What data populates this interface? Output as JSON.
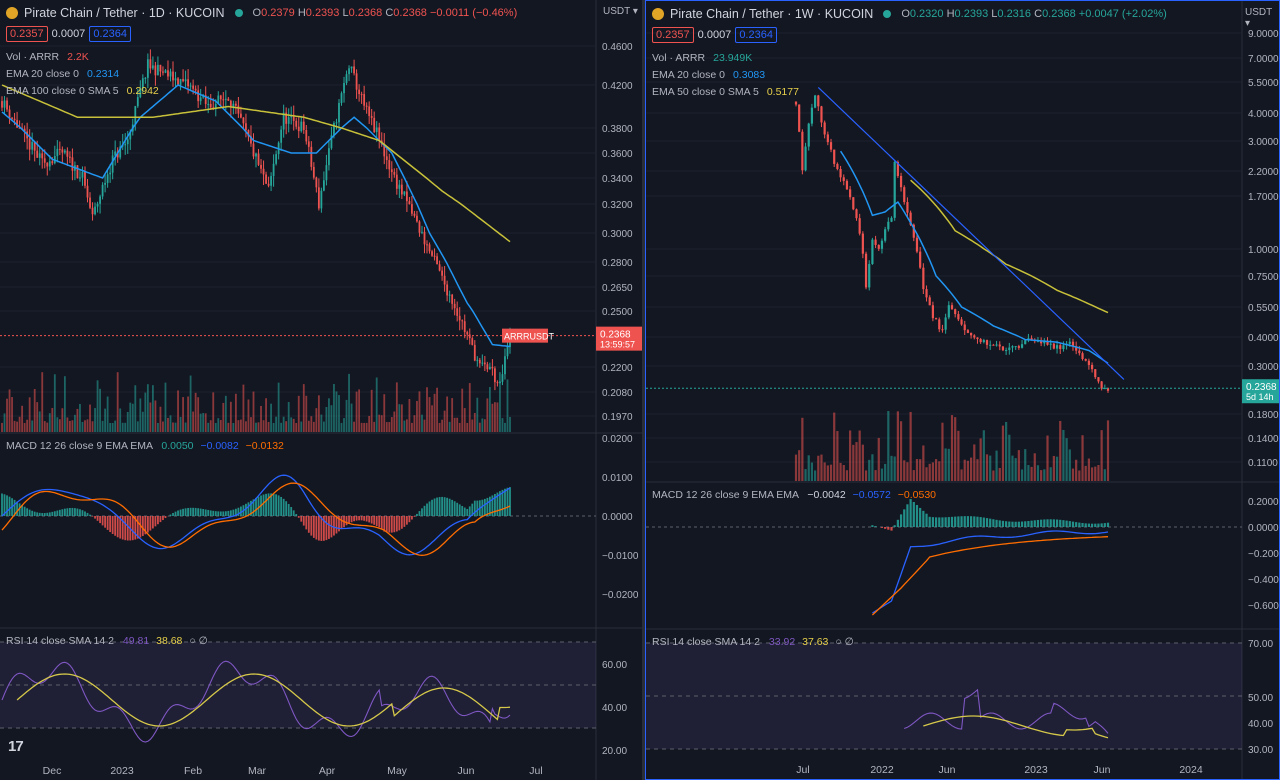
{
  "left": {
    "title": "Pirate Chain / Tether · 1D · KUCOIN",
    "ohlc": {
      "o_label": "O",
      "o": "0.2379",
      "h_label": "H",
      "h": "0.2393",
      "l_label": "L",
      "l": "0.2368",
      "c_label": "C",
      "c": "0.2368",
      "chg": "−0.0011 (−0.46%)"
    },
    "bid": "0.2357",
    "spread": "0.0007",
    "ask": "0.2364",
    "vol_label": "Vol · ARRR",
    "vol_value": "2.2K",
    "ema1_label": "EMA 20 close 0",
    "ema1_value": "0.2314",
    "ema2_label": "EMA 100 close 0 SMA 5",
    "ema2_value": "0.2942",
    "currency": "USDT ▾",
    "price_label_symbol": "ARRRUSDT",
    "price_label_value": "0.2368",
    "price_label_timer": "13:59:57",
    "macd_title": "MACD 12 26 close 9 EMA EMA",
    "macd_values": [
      "0.0050",
      "−0.0082",
      "−0.0132"
    ],
    "rsi_title": "RSI 14 close SMA 14 2",
    "rsi_values": [
      "49.81",
      "38.68"
    ],
    "price_axis": [
      "0.4600",
      "0.4200",
      "0.3800",
      "0.3600",
      "0.3400",
      "0.3200",
      "0.3000",
      "0.2800",
      "0.2650",
      "0.2500",
      "0.2200",
      "0.2080",
      "0.1970"
    ],
    "macd_axis": [
      "0.0200",
      "0.0100",
      "0.0000",
      "−0.0100",
      "−0.0200"
    ],
    "rsi_axis": [
      "60.00",
      "40.00",
      "20.00"
    ],
    "time_axis": [
      "Dec",
      "2023",
      "Feb",
      "Mar",
      "Apr",
      "May",
      "Jun",
      "Jul"
    ]
  },
  "right": {
    "title": "Pirate Chain / Tether · 1W · KUCOIN",
    "ohlc": {
      "o_label": "O",
      "o": "0.2320",
      "h_label": "H",
      "h": "0.2393",
      "l_label": "L",
      "l": "0.2316",
      "c_label": "C",
      "c": "0.2368",
      "chg": "+0.0047 (+2.02%)"
    },
    "bid": "0.2357",
    "spread": "0.0007",
    "ask": "0.2364",
    "vol_label": "Vol · ARRR",
    "vol_value": "23.949K",
    "ema1_label": "EMA 20 close 0",
    "ema1_value": "0.3083",
    "ema2_label": "EMA 50 close 0 SMA 5",
    "ema2_value": "0.5177",
    "currency": "USDT ▾",
    "price_label_value": "0.2368",
    "price_label_timer": "5d 14h",
    "macd_title": "MACD 12 26 close 9 EMA EMA",
    "macd_values": [
      "−0.0042",
      "−0.0572",
      "−0.0530"
    ],
    "rsi_title": "RSI 14 close SMA 14 2",
    "rsi_values": [
      "33.92",
      "37.63"
    ],
    "price_axis": [
      "9.0000",
      "7.0000",
      "5.5000",
      "4.0000",
      "3.0000",
      "2.2000",
      "1.7000",
      "1.0000",
      "0.7500",
      "0.5500",
      "0.4000",
      "0.3000",
      "0.1800",
      "0.1400",
      "0.1100"
    ],
    "macd_axis": [
      "0.2000",
      "0.0000",
      "−0.2000",
      "−0.4000",
      "−0.6000"
    ],
    "rsi_axis": [
      "70.00",
      "50.00",
      "40.00",
      "30.00"
    ],
    "time_axis": [
      "Jul",
      "2022",
      "Jun",
      "2023",
      "Jun",
      "2024"
    ]
  },
  "colors": {
    "up": "#26a69a",
    "down": "#ef5350",
    "ema_fast": "#2196f3",
    "ema_slow": "#c8c13a",
    "macd": "#2962ff",
    "signal": "#ff6d00",
    "rsi": "#7e57c2",
    "rsi_ma": "#d5c84a",
    "trend": "#2962ff"
  },
  "chart_data": [
    {
      "type": "candlestick",
      "title": "Pirate Chain / Tether · 1D · KUCOIN",
      "interval": "1D",
      "yrange": [
        0.195,
        0.47
      ],
      "x_range": [
        "Nov 2022",
        "Jul 2023"
      ],
      "last_price": 0.2368,
      "close_waypoints": [
        [
          0,
          0.405
        ],
        [
          8,
          0.375
        ],
        [
          16,
          0.352
        ],
        [
          24,
          0.36
        ],
        [
          32,
          0.34
        ],
        [
          36,
          0.31
        ],
        [
          44,
          0.355
        ],
        [
          50,
          0.37
        ],
        [
          58,
          0.44
        ],
        [
          66,
          0.43
        ],
        [
          74,
          0.42
        ],
        [
          82,
          0.4
        ],
        [
          90,
          0.41
        ],
        [
          98,
          0.37
        ],
        [
          106,
          0.33
        ],
        [
          112,
          0.39
        ],
        [
          120,
          0.38
        ],
        [
          126,
          0.32
        ],
        [
          132,
          0.38
        ],
        [
          138,
          0.44
        ],
        [
          144,
          0.4
        ],
        [
          150,
          0.37
        ],
        [
          156,
          0.34
        ],
        [
          164,
          0.31
        ],
        [
          172,
          0.28
        ],
        [
          178,
          0.26
        ],
        [
          184,
          0.24
        ],
        [
          190,
          0.22
        ],
        [
          194,
          0.22
        ],
        [
          198,
          0.21
        ],
        [
          202,
          0.237
        ]
      ],
      "ema20_waypoints": [
        [
          0,
          0.395
        ],
        [
          20,
          0.355
        ],
        [
          40,
          0.34
        ],
        [
          55,
          0.39
        ],
        [
          70,
          0.42
        ],
        [
          85,
          0.405
        ],
        [
          100,
          0.37
        ],
        [
          115,
          0.36
        ],
        [
          125,
          0.36
        ],
        [
          140,
          0.39
        ],
        [
          155,
          0.36
        ],
        [
          170,
          0.3
        ],
        [
          185,
          0.255
        ],
        [
          195,
          0.232
        ],
        [
          202,
          0.231
        ]
      ],
      "ema100_waypoints": [
        [
          0,
          0.42
        ],
        [
          30,
          0.39
        ],
        [
          60,
          0.39
        ],
        [
          90,
          0.4
        ],
        [
          120,
          0.39
        ],
        [
          150,
          0.37
        ],
        [
          175,
          0.33
        ],
        [
          202,
          0.294
        ]
      ],
      "macd_range": [
        -0.025,
        0.022
      ],
      "rsi_range": [
        18,
        75
      ]
    },
    {
      "type": "candlestick",
      "title": "Pirate Chain / Tether · 1W · KUCOIN",
      "interval": "1W",
      "scale": "log",
      "yrange": [
        0.1,
        10
      ],
      "x_range": [
        "Jun 2021",
        "Mar 2024"
      ],
      "last_price": 0.2368,
      "close_waypoints": [
        [
          0,
          4.5
        ],
        [
          2,
          2.2
        ],
        [
          4,
          3.6
        ],
        [
          6,
          4.8
        ],
        [
          9,
          3.2
        ],
        [
          12,
          2.4
        ],
        [
          16,
          1.8
        ],
        [
          20,
          1.2
        ],
        [
          22,
          0.65
        ],
        [
          24,
          1.1
        ],
        [
          26,
          1.0
        ],
        [
          30,
          1.4
        ],
        [
          31,
          2.4
        ],
        [
          34,
          1.6
        ],
        [
          37,
          1.1
        ],
        [
          40,
          0.65
        ],
        [
          43,
          0.5
        ],
        [
          46,
          0.42
        ],
        [
          48,
          0.55
        ],
        [
          50,
          0.5
        ],
        [
          54,
          0.42
        ],
        [
          58,
          0.38
        ],
        [
          62,
          0.37
        ],
        [
          66,
          0.35
        ],
        [
          70,
          0.36
        ],
        [
          74,
          0.4
        ],
        [
          78,
          0.38
        ],
        [
          82,
          0.36
        ],
        [
          86,
          0.38
        ],
        [
          90,
          0.33
        ],
        [
          94,
          0.27
        ],
        [
          96,
          0.23
        ],
        [
          98,
          0.237
        ]
      ],
      "ema20_waypoints": [
        [
          14,
          2.7
        ],
        [
          20,
          1.9
        ],
        [
          24,
          1.4
        ],
        [
          28,
          1.45
        ],
        [
          32,
          1.6
        ],
        [
          36,
          1.3
        ],
        [
          44,
          0.75
        ],
        [
          52,
          0.55
        ],
        [
          62,
          0.45
        ],
        [
          72,
          0.39
        ],
        [
          82,
          0.38
        ],
        [
          92,
          0.35
        ],
        [
          98,
          0.308
        ]
      ],
      "ema50_waypoints": [
        [
          36,
          2.0
        ],
        [
          50,
          1.2
        ],
        [
          66,
          0.85
        ],
        [
          82,
          0.65
        ],
        [
          98,
          0.518
        ]
      ],
      "trendline": [
        [
          7,
          5.2
        ],
        [
          103,
          0.26
        ]
      ],
      "macd_range": [
        -0.65,
        0.25
      ],
      "rsi_range": [
        28,
        72
      ]
    }
  ]
}
